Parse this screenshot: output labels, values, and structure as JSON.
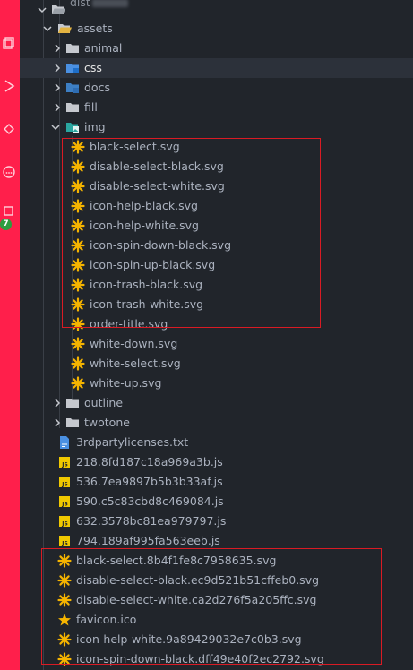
{
  "colors": {
    "activity_bar": "#ff1f4b",
    "highlight_box": "#d91b24",
    "svg_icon": "#f5b400",
    "js_icon": "#f0c800",
    "folder": "#c5c8ce",
    "txt_icon": "#4a90e2"
  },
  "activity_bar": {
    "icons": [
      "copy-icon",
      "run-icon",
      "source-control-icon",
      "debug-icon",
      "extensions-icon"
    ],
    "badge": "7"
  },
  "tree": {
    "dist": {
      "label": "dist"
    },
    "assets": {
      "label": "assets"
    },
    "folders": {
      "animal": "animal",
      "css": "css",
      "docs": "docs",
      "fill": "fill",
      "img": "img",
      "outline": "outline",
      "twotone": "twotone"
    },
    "img_files": [
      "black-select.svg",
      "disable-select-black.svg",
      "disable-select-white.svg",
      "icon-help-black.svg",
      "icon-help-white.svg",
      "icon-spin-down-black.svg",
      "icon-spin-up-black.svg",
      "icon-trash-black.svg",
      "icon-trash-white.svg",
      "order-title.svg",
      "white-down.svg",
      "white-select.svg",
      "white-up.svg"
    ],
    "dist_files": [
      "3rdpartylicenses.txt",
      "218.8fd187c18a969a3b.js",
      "536.7ea9897b5b3b33af.js",
      "590.c5c83cbd8c469084.js",
      "632.3578bc81ea979797.js",
      "794.189af995fa563eeb.js",
      "black-select.8b4f1fe8c7958635.svg",
      "disable-select-black.ec9d521b51cffeb0.svg",
      "disable-select-white.ca2d276f5a205ffc.svg",
      "favicon.ico",
      "icon-help-white.9a89429032e7c0b3.svg",
      "icon-spin-down-black.dff49e40f2ec2792.svg"
    ]
  }
}
